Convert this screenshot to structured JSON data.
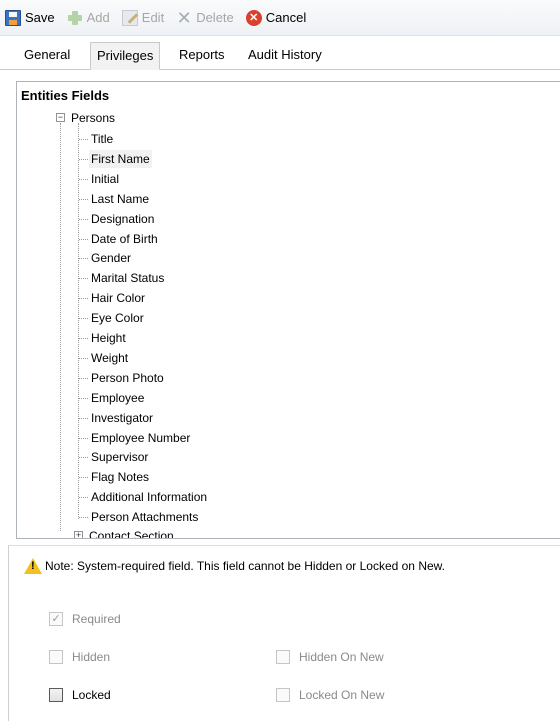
{
  "toolbar": {
    "save": "Save",
    "add": "Add",
    "edit": "Edit",
    "delete": "Delete",
    "cancel": "Cancel"
  },
  "tabs": [
    "General",
    "Privileges",
    "Reports",
    "Audit History"
  ],
  "active_tab": "Privileges",
  "tree": {
    "title": "Entities  Fields",
    "root": "Persons",
    "items": [
      "Title",
      "First Name",
      "Initial",
      "Last Name",
      "Designation",
      "Date of Birth",
      "Gender",
      "Marital Status",
      "Hair Color",
      "Eye Color",
      "Height",
      "Weight",
      "Person Photo",
      "Employee",
      "Investigator",
      "Employee Number",
      "Supervisor",
      "Flag Notes",
      "Additional Information",
      "Person Attachments"
    ],
    "selected_item": "First Name",
    "next_root": "Contact Section"
  },
  "note": "Note: System-required field. This field cannot be Hidden or Locked on New.",
  "options": {
    "required": {
      "label": "Required",
      "checked": true,
      "enabled": false
    },
    "hidden": {
      "label": "Hidden",
      "checked": false,
      "enabled": false
    },
    "hidden_on_new": {
      "label": "Hidden On New",
      "checked": false,
      "enabled": false
    },
    "locked": {
      "label": "Locked",
      "checked": false,
      "enabled": true
    },
    "locked_on_new": {
      "label": "Locked On New",
      "checked": false,
      "enabled": false
    }
  },
  "icons": {
    "save": "save-icon",
    "add": "add-icon",
    "edit": "edit-icon",
    "delete": "delete-icon",
    "cancel": "cancel-icon",
    "warning": "warning-icon"
  }
}
